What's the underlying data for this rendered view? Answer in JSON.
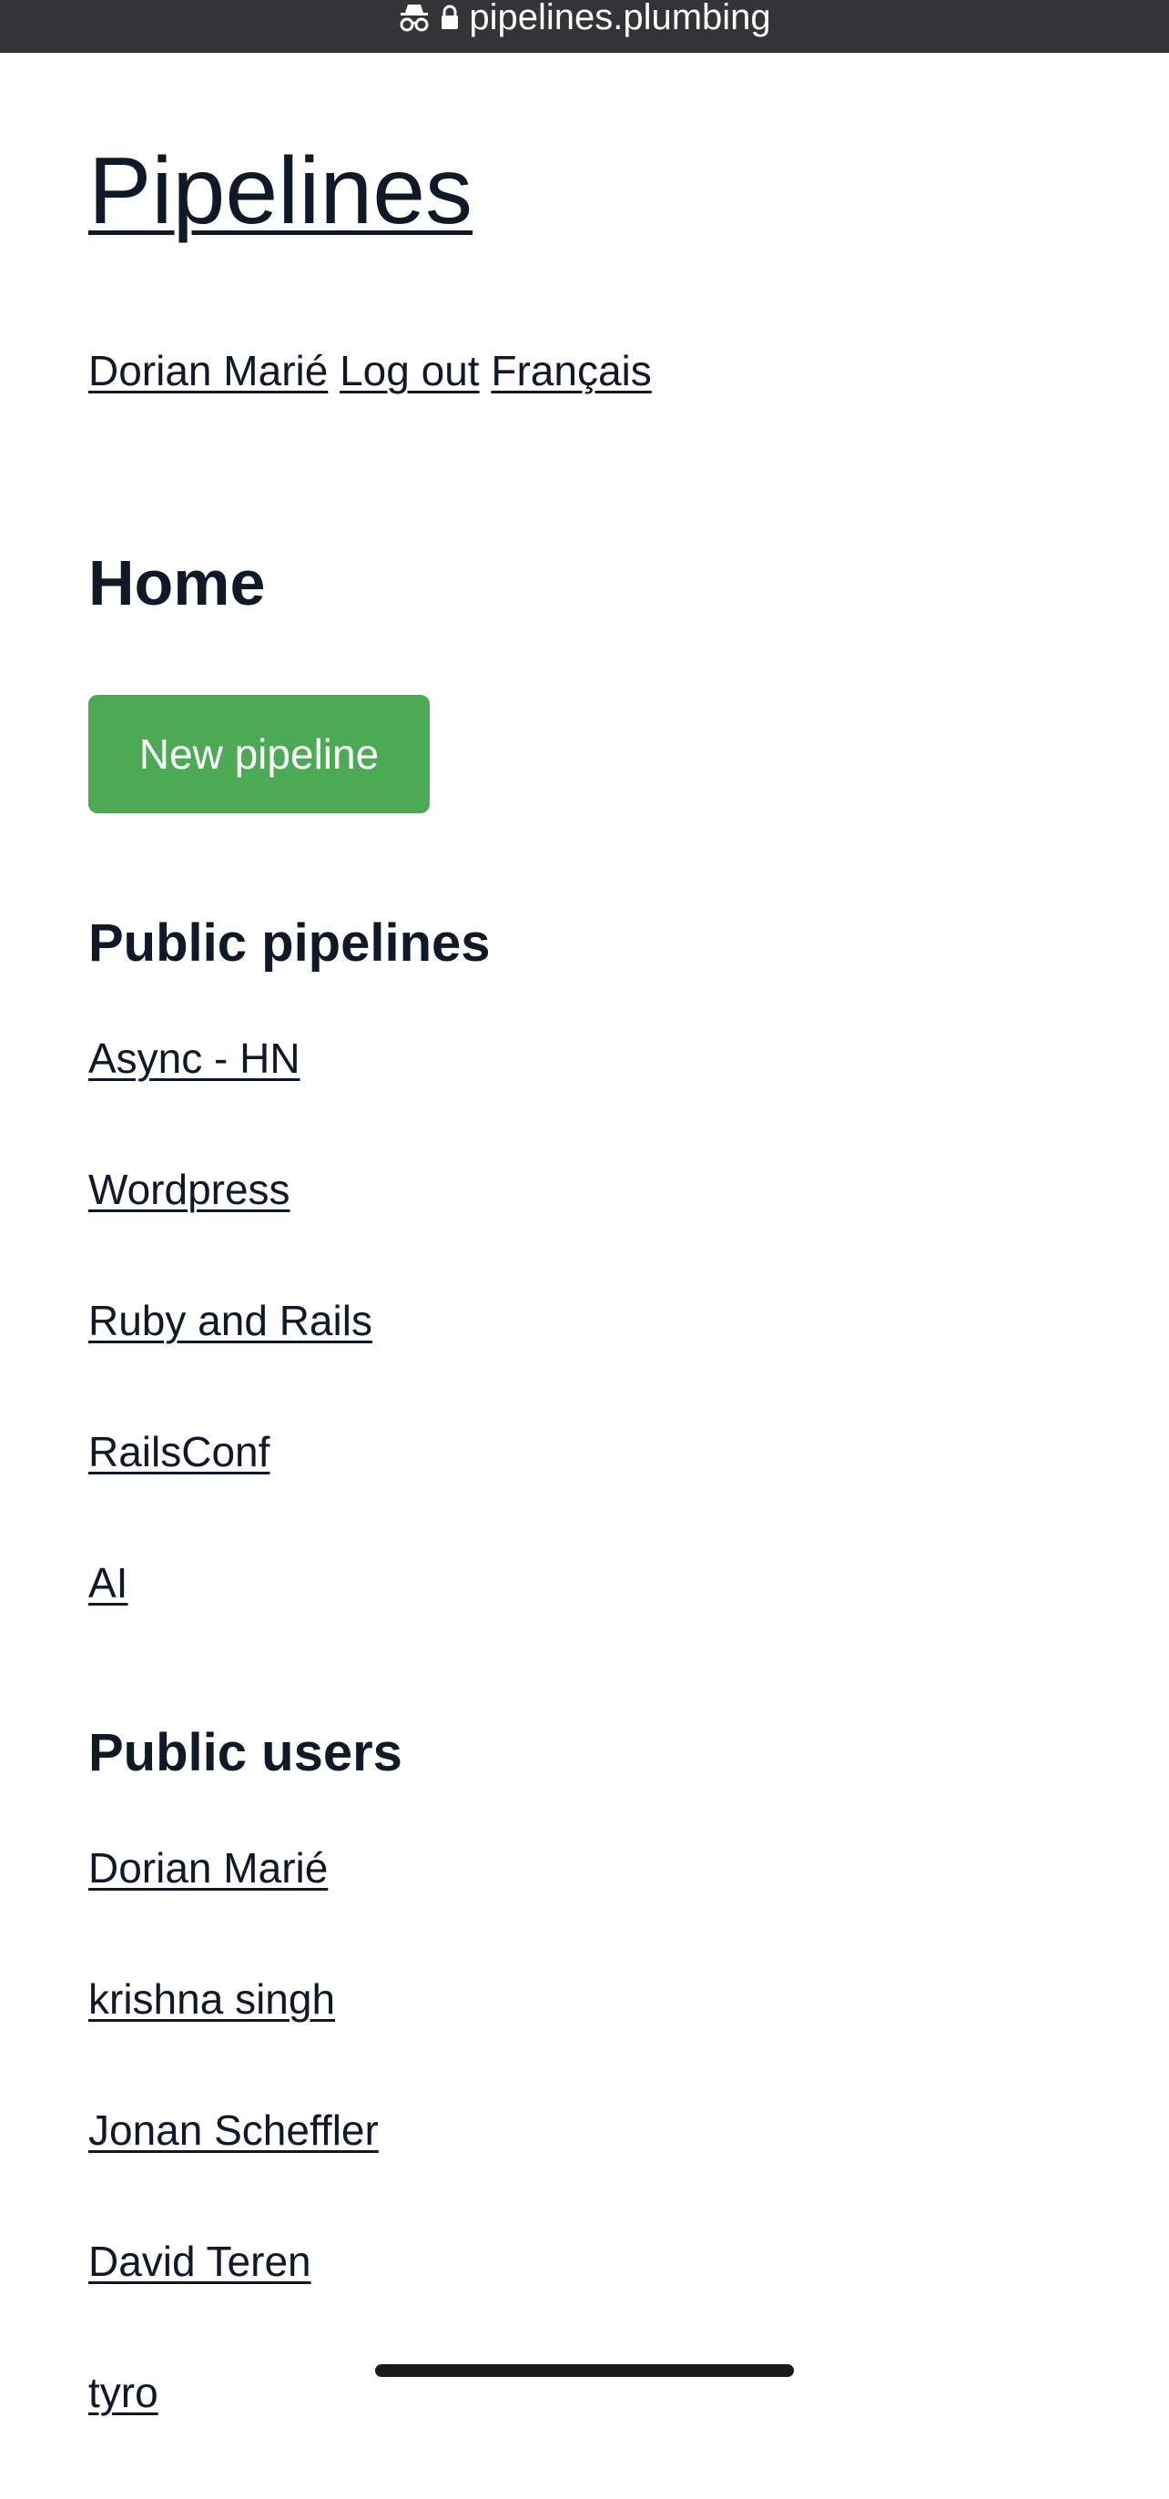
{
  "browser": {
    "url": "pipelines.plumbing",
    "incognito_icon": "incognito-icon",
    "lock_icon": "lock-icon"
  },
  "site": {
    "title": "Pipelines"
  },
  "nav": {
    "user_name": "Dorian Marié",
    "logout": "Log out",
    "language": "Français"
  },
  "main": {
    "heading": "Home",
    "new_pipeline_button": "New pipeline",
    "button_color": "#4caa55",
    "public_pipelines": {
      "heading": "Public pipelines",
      "items": [
        "Async - HN",
        "Wordpress",
        "Ruby and Rails",
        "RailsConf",
        "AI"
      ]
    },
    "public_users": {
      "heading": "Public users",
      "items": [
        "Dorian Marié",
        "krishna singh",
        "Jonan Scheffler",
        "David Teren",
        "tyro"
      ]
    }
  }
}
